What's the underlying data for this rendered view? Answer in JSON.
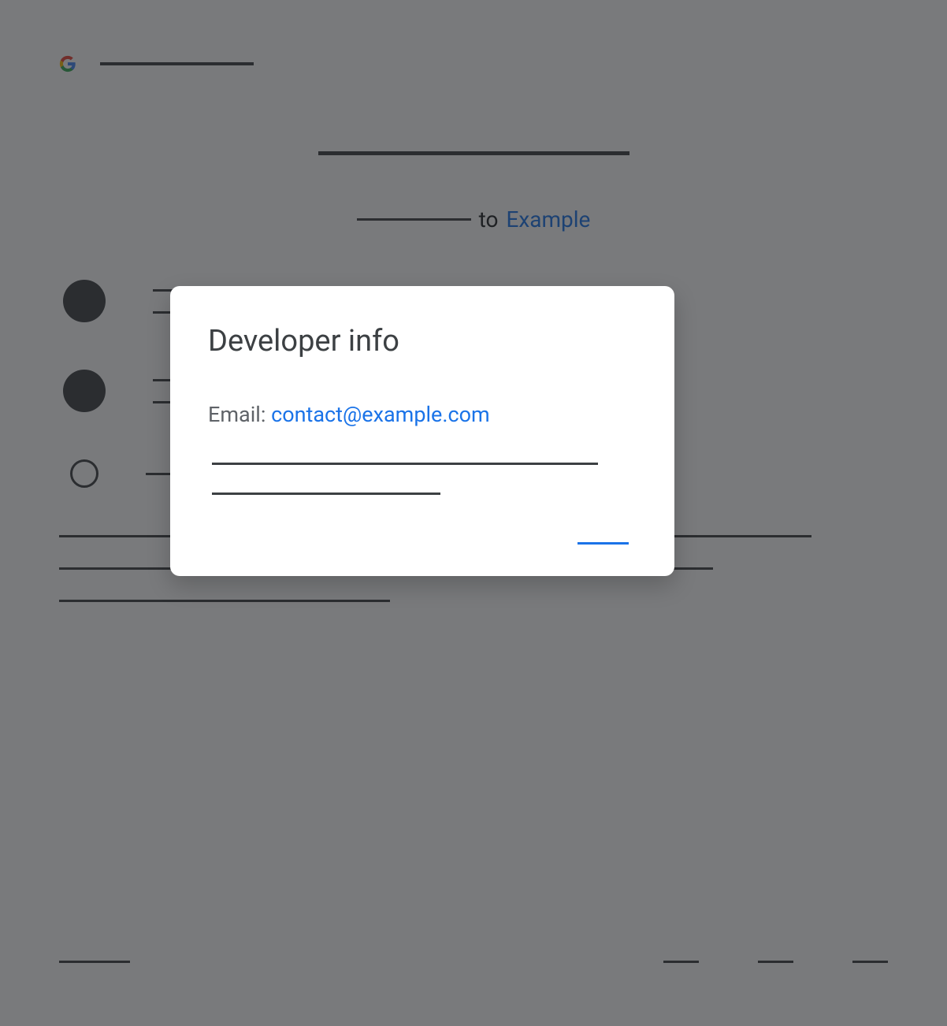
{
  "page": {
    "subtitle_to": "to",
    "subtitle_app": "Example"
  },
  "modal": {
    "title": "Developer info",
    "email_label": "Email: ",
    "email_value": "contact@example.com"
  }
}
